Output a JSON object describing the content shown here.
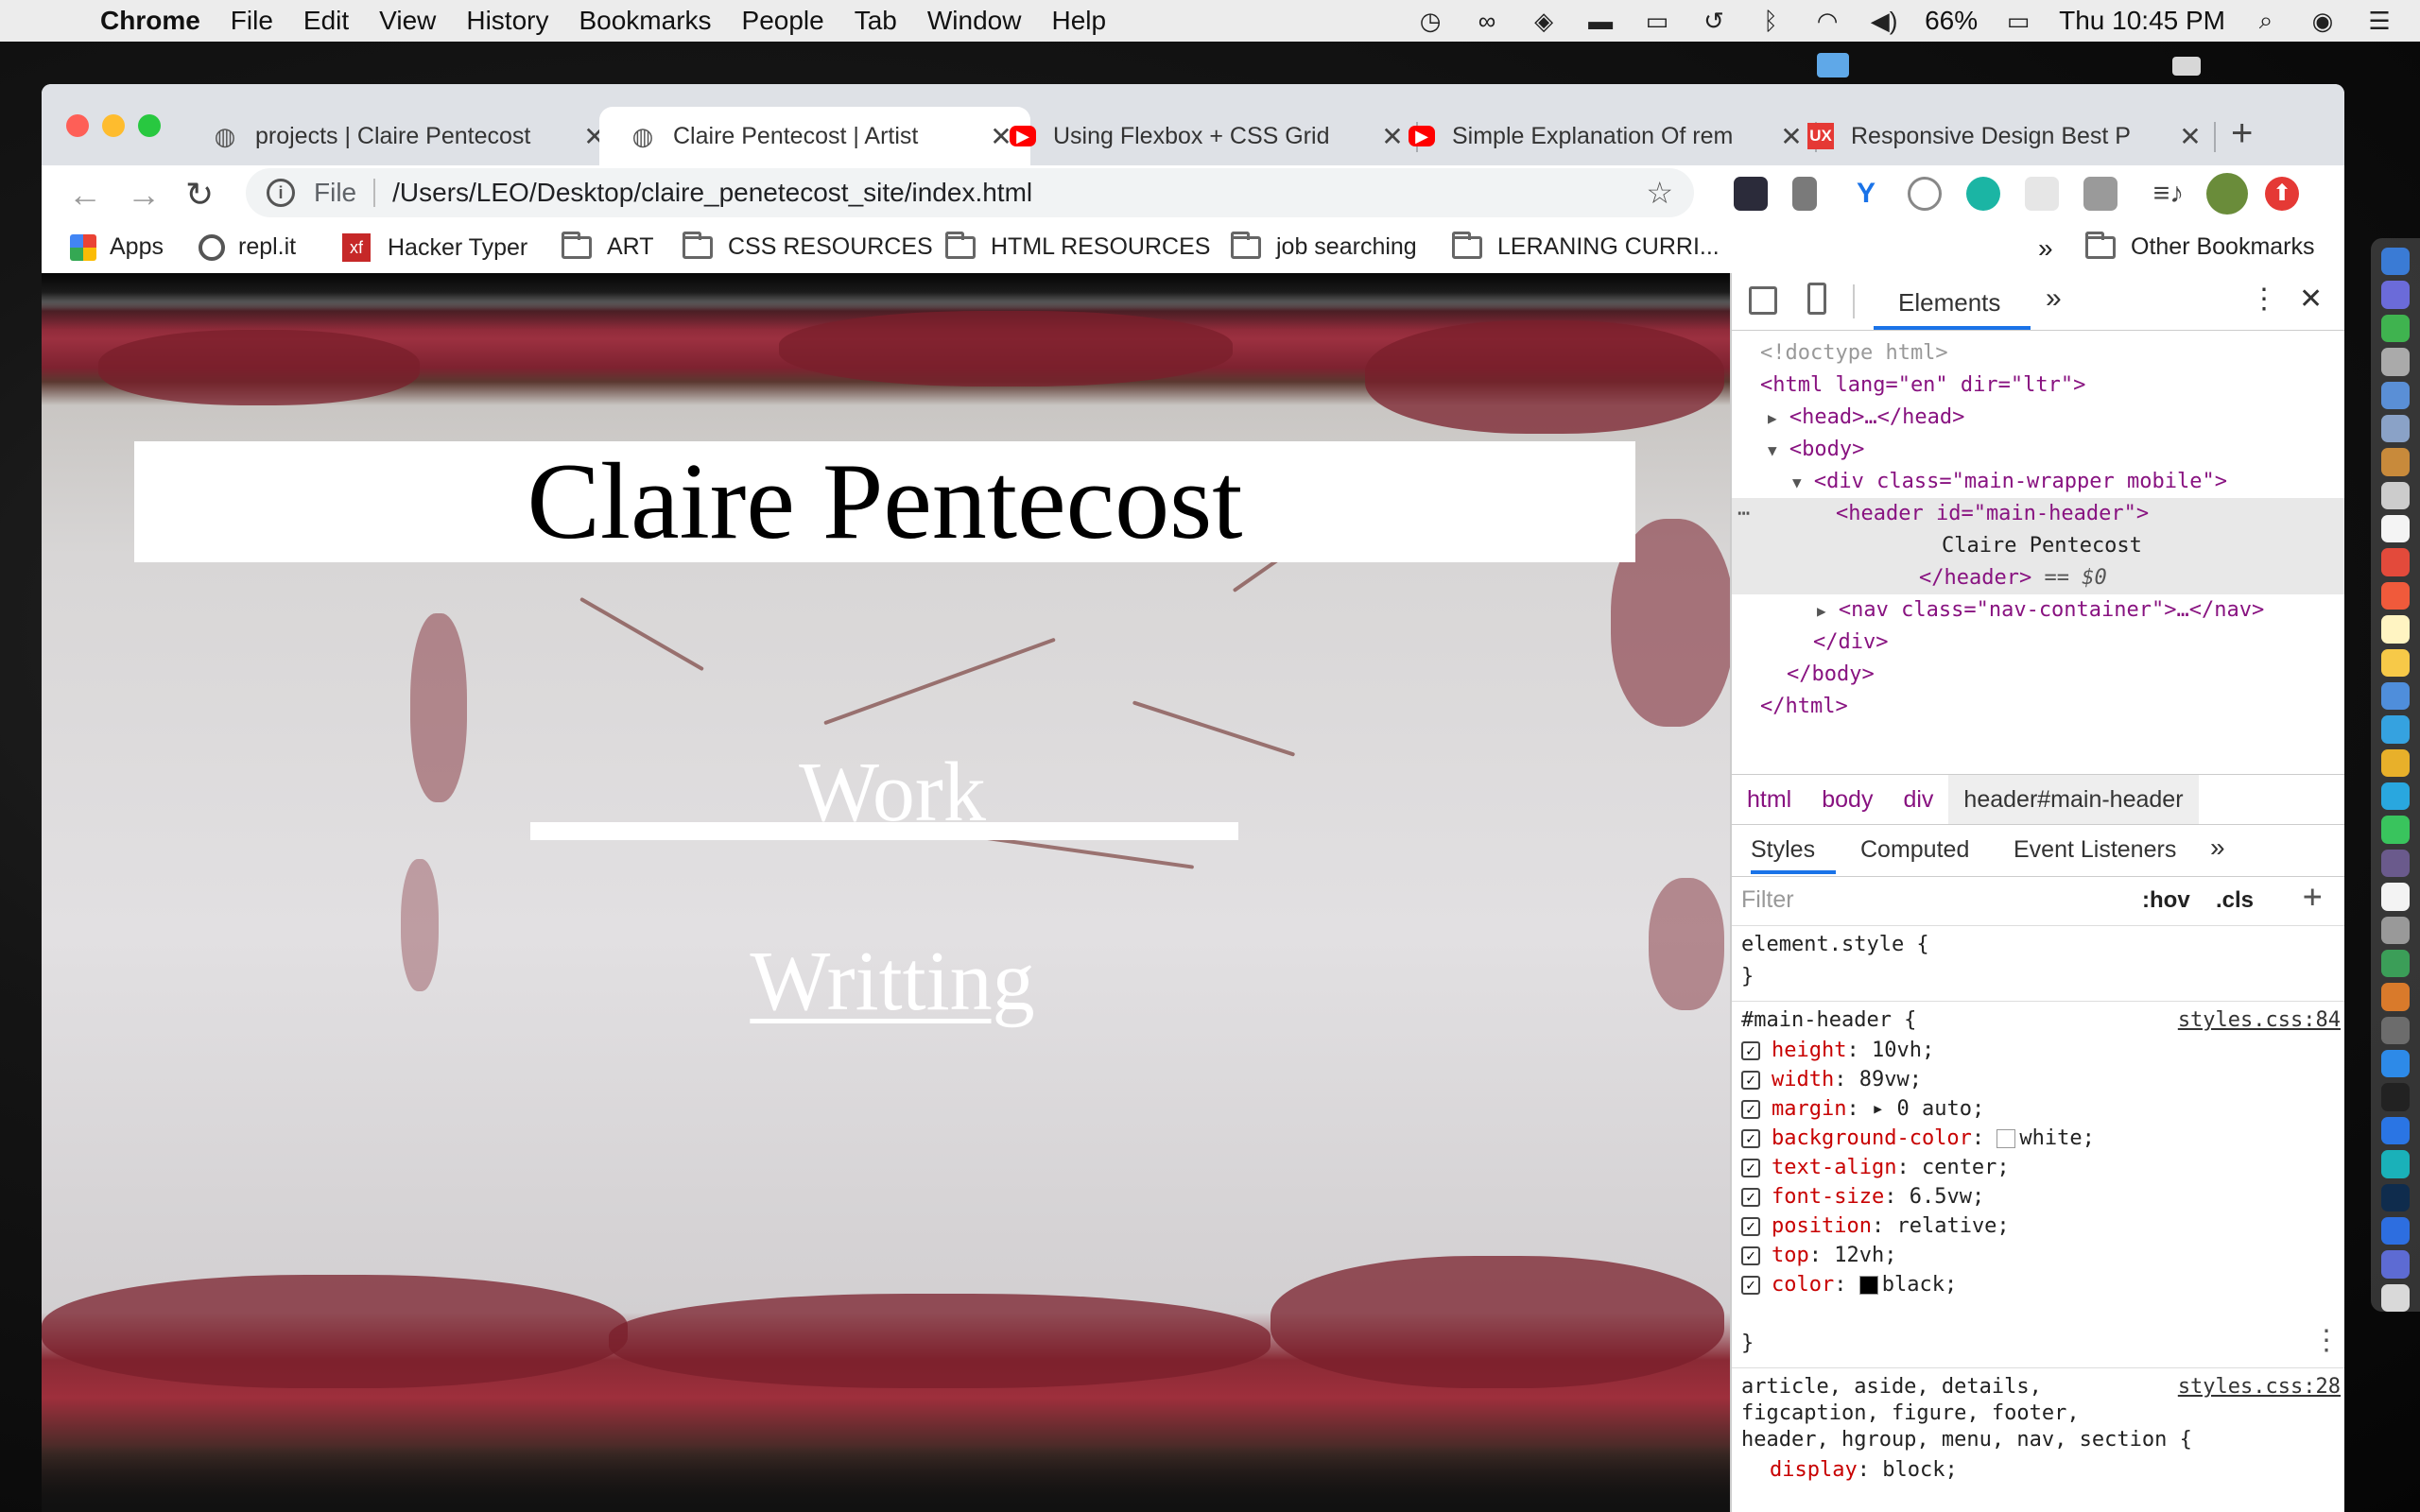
{
  "menubar": {
    "app": "Chrome",
    "items": [
      "File",
      "Edit",
      "View",
      "History",
      "Bookmarks",
      "People",
      "Tab",
      "Window",
      "Help"
    ],
    "battery": "66%",
    "clock": "Thu 10:45 PM"
  },
  "tabs": [
    {
      "title": "projects | Claire Pentecost",
      "favicon": "globe-icon"
    },
    {
      "title": "Claire Pentecost | Artist",
      "favicon": "globe-icon",
      "active": true
    },
    {
      "title": "Using Flexbox + CSS Grid",
      "favicon": "youtube-icon"
    },
    {
      "title": "Simple Explanation Of rem",
      "favicon": "youtube-icon"
    },
    {
      "title": "Responsive Design Best P",
      "favicon": "ux-icon"
    }
  ],
  "toolbar": {
    "scheme": "File",
    "url": "/Users/LEO/Desktop/claire_penetecost_site/index.html"
  },
  "bookmarks": {
    "items": [
      "Apps",
      "repl.it",
      "Hacker Typer",
      "ART",
      "CSS RESOURCES",
      "HTML RESOURCES",
      "job searching",
      "LERANING CURRI..."
    ],
    "overflow": "»",
    "other": "Other Bookmarks"
  },
  "site": {
    "header": "Claire Pentecost",
    "nav": [
      "Work",
      "Writting"
    ]
  },
  "devtools": {
    "panel": "Elements",
    "dom": {
      "doctype": "<!doctype html>",
      "html_open": "<html lang=\"en\" dir=\"ltr\">",
      "head": "<head>…</head>",
      "body_open": "<body>",
      "div_open": "<div class=\"main-wrapper mobile\">",
      "header_open": "<header id=\"main-header\">",
      "header_text": "Claire Pentecost",
      "header_close": "</header>",
      "sel_marker": "== $0",
      "nav": "<nav class=\"nav-container\">…</nav>",
      "div_close": "</div>",
      "body_close": "</body>",
      "html_close": "</html>"
    },
    "breadcrumbs": [
      "html",
      "body",
      "div",
      "header#main-header"
    ],
    "style_tabs": [
      "Styles",
      "Computed",
      "Event Listeners"
    ],
    "filter_placeholder": "Filter",
    "hov": ":hov",
    "cls": ".cls",
    "element_style": "element.style {",
    "close_brace": "}",
    "rule1": {
      "selector": "#main-header {",
      "source": "styles.css:84",
      "props": [
        {
          "name": "height",
          "value": "10vh;"
        },
        {
          "name": "width",
          "value": "89vw;"
        },
        {
          "name": "margin",
          "value": "▸ 0 auto;"
        },
        {
          "name": "background-color",
          "value": "white;",
          "swatch": "#ffffff"
        },
        {
          "name": "text-align",
          "value": "center;"
        },
        {
          "name": "font-size",
          "value": "6.5vw;"
        },
        {
          "name": "position",
          "value": "relative;"
        },
        {
          "name": "top",
          "value": "12vh;"
        },
        {
          "name": "color",
          "value": "black;",
          "swatch": "#000000"
        }
      ]
    },
    "rule2": {
      "selector_line1": "article, aside, details,",
      "selector_line2": "figcaption, figure, footer,",
      "selector_line3": "header, hgroup, menu, nav, section {",
      "source": "styles.css:28",
      "prop": {
        "name": "display",
        "value": "block;"
      }
    }
  }
}
